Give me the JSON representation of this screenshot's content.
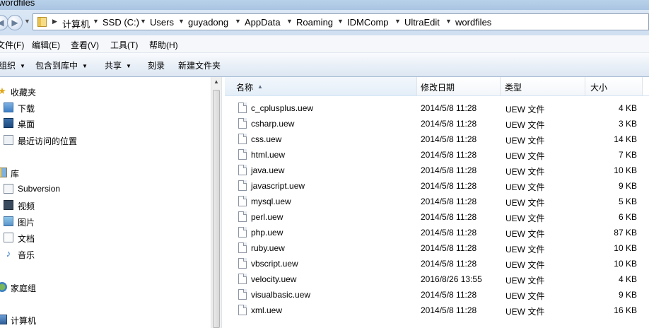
{
  "window": {
    "title": "wordfiles"
  },
  "address": {
    "crumbs": [
      "计算机",
      "SSD (C:)",
      "Users",
      "guyadong",
      "AppData",
      "Roaming",
      "IDMComp",
      "UltraEdit",
      "wordfiles"
    ]
  },
  "menu": {
    "items": [
      "文件(F)",
      "编辑(E)",
      "查看(V)",
      "工具(T)",
      "帮助(H)"
    ]
  },
  "toolbar": {
    "organize": "组织",
    "include_library": "包含到库中",
    "share": "共享",
    "burn": "刻录",
    "new_folder": "新建文件夹"
  },
  "nav": {
    "favorites": {
      "label": "收藏夹",
      "items": [
        "下载",
        "桌面",
        "最近访问的位置"
      ]
    },
    "libraries": {
      "label": "库",
      "items": [
        "Subversion",
        "视频",
        "图片",
        "文档",
        "音乐"
      ]
    },
    "homegroup": "家庭组",
    "computer": "计算机"
  },
  "columns": {
    "name": "名称",
    "modified": "修改日期",
    "type": "类型",
    "size": "大小"
  },
  "files": [
    {
      "name": "c_cplusplus.uew",
      "modified": "2014/5/8 11:28",
      "type": "UEW 文件",
      "size": "4 KB"
    },
    {
      "name": "csharp.uew",
      "modified": "2014/5/8 11:28",
      "type": "UEW 文件",
      "size": "3 KB"
    },
    {
      "name": "css.uew",
      "modified": "2014/5/8 11:28",
      "type": "UEW 文件",
      "size": "14 KB"
    },
    {
      "name": "html.uew",
      "modified": "2014/5/8 11:28",
      "type": "UEW 文件",
      "size": "7 KB"
    },
    {
      "name": "java.uew",
      "modified": "2014/5/8 11:28",
      "type": "UEW 文件",
      "size": "10 KB"
    },
    {
      "name": "javascript.uew",
      "modified": "2014/5/8 11:28",
      "type": "UEW 文件",
      "size": "9 KB"
    },
    {
      "name": "mysql.uew",
      "modified": "2014/5/8 11:28",
      "type": "UEW 文件",
      "size": "5 KB"
    },
    {
      "name": "perl.uew",
      "modified": "2014/5/8 11:28",
      "type": "UEW 文件",
      "size": "6 KB"
    },
    {
      "name": "php.uew",
      "modified": "2014/5/8 11:28",
      "type": "UEW 文件",
      "size": "87 KB"
    },
    {
      "name": "ruby.uew",
      "modified": "2014/5/8 11:28",
      "type": "UEW 文件",
      "size": "10 KB"
    },
    {
      "name": "vbscript.uew",
      "modified": "2014/5/8 11:28",
      "type": "UEW 文件",
      "size": "10 KB"
    },
    {
      "name": "velocity.uew",
      "modified": "2016/8/26 13:55",
      "type": "UEW 文件",
      "size": "4 KB"
    },
    {
      "name": "visualbasic.uew",
      "modified": "2014/5/8 11:28",
      "type": "UEW 文件",
      "size": "9 KB"
    },
    {
      "name": "xml.uew",
      "modified": "2014/5/8 11:28",
      "type": "UEW 文件",
      "size": "16 KB"
    }
  ]
}
